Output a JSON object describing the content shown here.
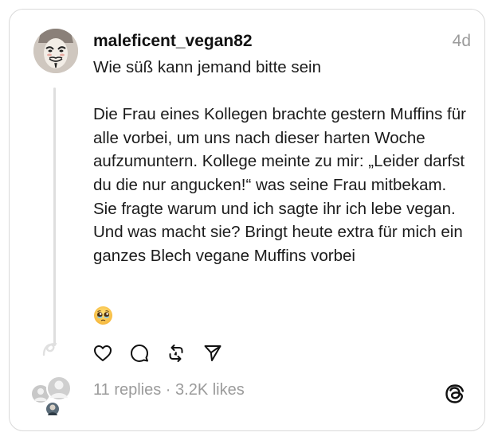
{
  "post": {
    "username": "maleficent_vegan82",
    "time": "4d",
    "text": "Wie süß kann jemand bitte sein\n\nDie Frau eines Kollegen brachte gestern Muffins für alle vorbei, um uns nach dieser harten Woche aufzumuntern. Kollege meinte zu mir: „Leider darfst du die nur angucken!“ was seine Frau mitbekam. Sie fragte warum und ich sagte ihr ich lebe vegan.\nUnd was macht sie? Bringt heute extra für mich ein ganzes Blech vegane Muffins vorbei",
    "emoji": "pleading-face-with-tears"
  },
  "actions": {
    "icons": [
      "heart-icon",
      "comment-icon",
      "repost-icon",
      "share-icon"
    ]
  },
  "stats": {
    "replies": "11 replies",
    "separator": " · ",
    "likes": "3.2K likes"
  },
  "colors": {
    "border": "#d9d9d9",
    "muted": "#9b9b9b",
    "text": "#1b1b1b"
  }
}
